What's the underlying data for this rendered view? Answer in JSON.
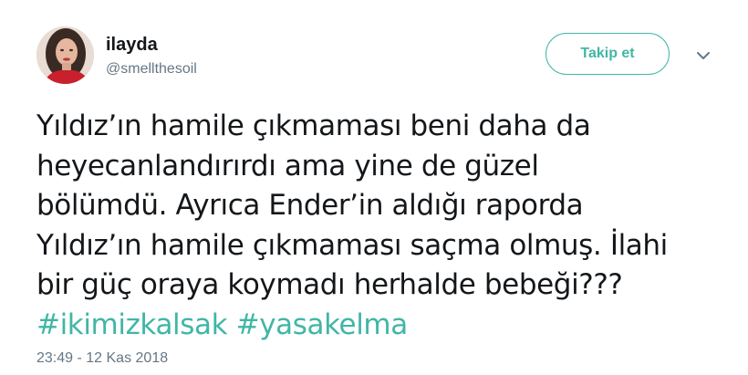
{
  "user": {
    "display_name": "ilayda",
    "handle": "@smellthesoil"
  },
  "follow_button": {
    "label": "Takip et"
  },
  "menu": {
    "icon": "chevron-down-icon"
  },
  "tweet": {
    "lines": [
      "Yıldız’ın hamile çıkmaması beni daha da",
      "heyecanlandırırdı ama yine de güzel",
      "bölümdü. Ayrıca Ender’in aldığı raporda",
      "Yıldız’ın hamile çıkmaması saçma olmuş. İlahi",
      "bir güç oraya koymadı herhalde bebeği???"
    ],
    "hashtags": [
      "#ikimizkalsak",
      "#yasakelma"
    ]
  },
  "timestamp": "23:49 - 12 Kas 2018",
  "colors": {
    "accent": "#41b6a6",
    "text": "#14171a",
    "secondary_text": "#657786"
  }
}
